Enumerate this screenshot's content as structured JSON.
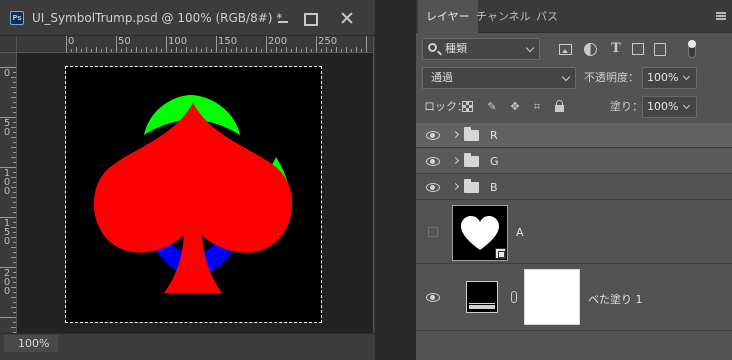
{
  "document": {
    "title": "UI_SymbolTrump.psd @ 100% (RGB/8#) *",
    "app_badge": "Ps",
    "zoom": "100%",
    "ruler_h_labels": [
      "0",
      "50",
      "100",
      "150",
      "200",
      "250"
    ],
    "ruler_v_labels": [
      "0",
      "50",
      "100",
      "150",
      "200"
    ],
    "canvas_colors": {
      "background": "#000000",
      "red": "#ff0000",
      "green": "#00ff00",
      "blue": "#0000ff"
    }
  },
  "panel": {
    "tabs": [
      {
        "label": "レイヤー",
        "active": true
      },
      {
        "label": "チャンネル",
        "active": false
      },
      {
        "label": "パス",
        "active": false
      }
    ],
    "filter_kind": "種類",
    "blend_mode": "通過",
    "opacity_label": "不透明度：",
    "opacity_value": "100%",
    "lock_label": "ロック：",
    "fill_label": "塗り：",
    "fill_value": "100%",
    "filter_icons": [
      "image-filter-icon",
      "adjustment-filter-icon",
      "type-filter-icon",
      "shape-filter-icon",
      "smart-object-filter-icon"
    ],
    "lock_icons": [
      "lock-transparent-icon",
      "lock-image-icon",
      "lock-position-icon",
      "lock-artboard-icon",
      "lock-all-icon"
    ]
  },
  "layers": [
    {
      "name": "R",
      "type": "group",
      "visible": true
    },
    {
      "name": "G",
      "type": "group",
      "visible": true
    },
    {
      "name": "B",
      "type": "group",
      "visible": true
    },
    {
      "name": "A",
      "type": "pixel",
      "visible": false
    },
    {
      "name": "ベた塗り 1",
      "type": "fill",
      "visible": true
    }
  ]
}
